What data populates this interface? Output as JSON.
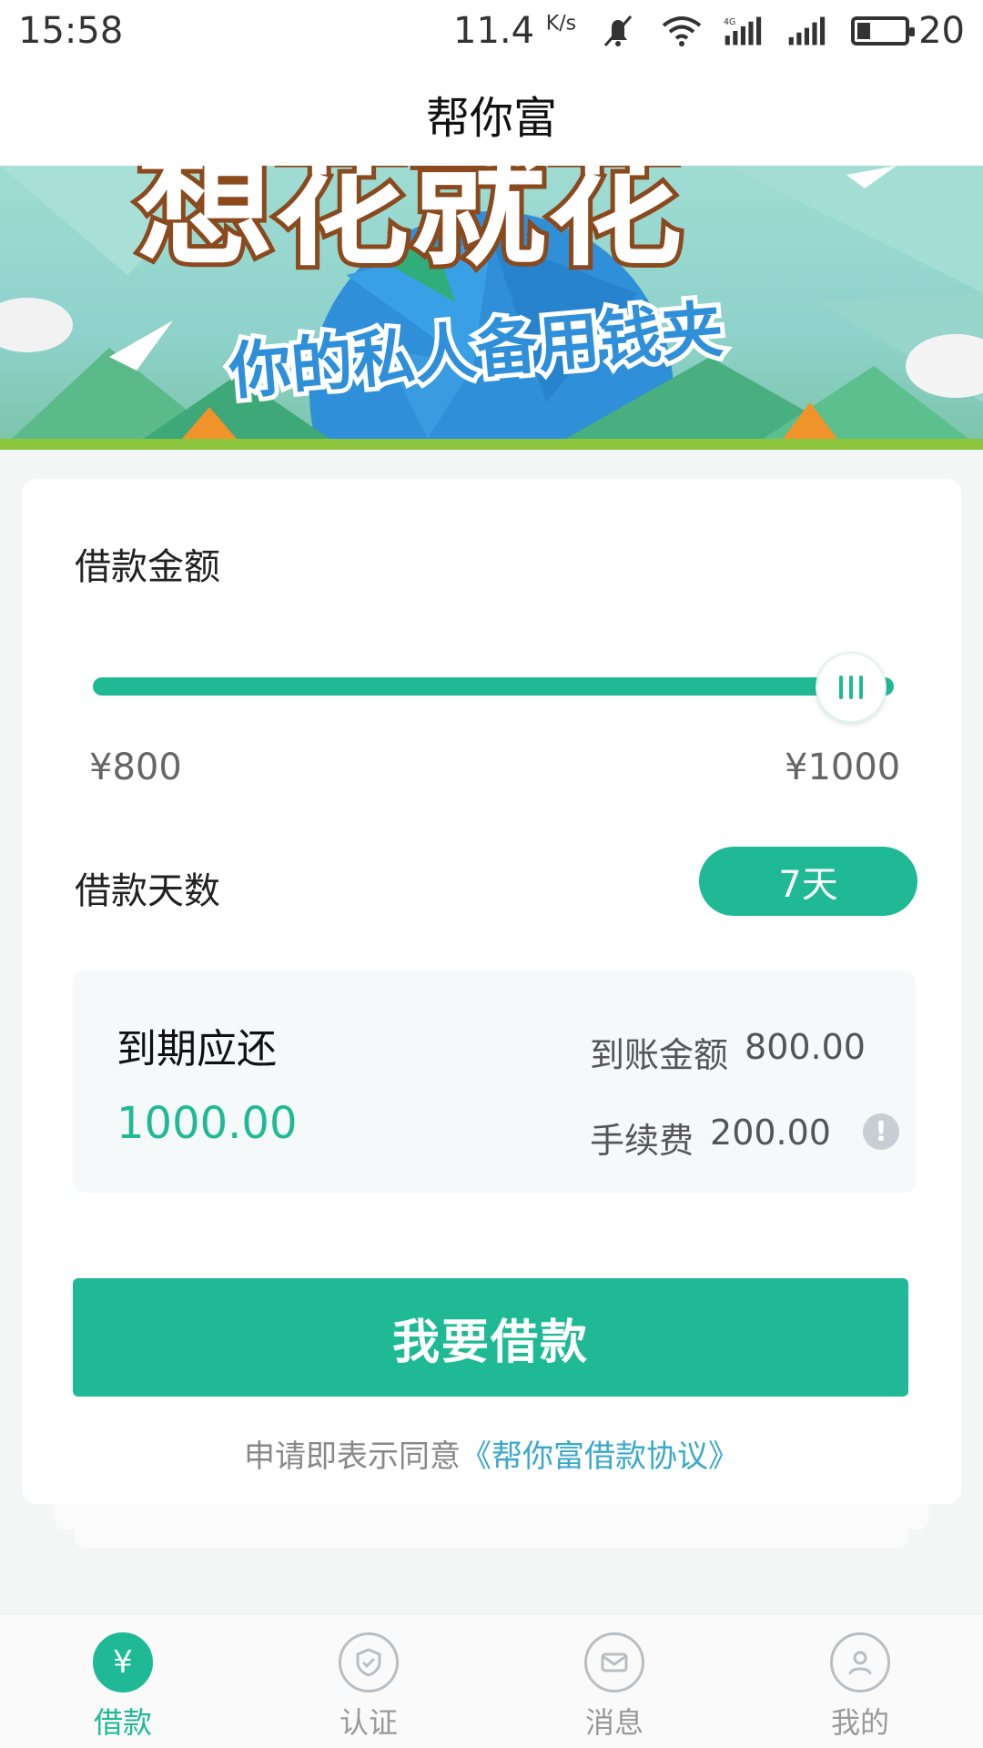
{
  "status_bar": {
    "time": "15:58",
    "speed_value": "11.4",
    "speed_unit": "K/s",
    "network": "4G",
    "battery": "20"
  },
  "nav": {
    "title": "帮你富"
  },
  "banner": {
    "headline": "想花就花",
    "tagline": "你的私人备用钱夹"
  },
  "loan": {
    "amount_label": "借款金额",
    "amount_min": "¥800",
    "amount_max": "¥1000",
    "slider_fraction": 1.0,
    "days_label": "借款天数",
    "days_value": "7天",
    "summary": {
      "due_title": "到期应还",
      "due_amount": "1000.00",
      "received_label": "到账金额",
      "received_value": "800.00",
      "fee_label": "手续费",
      "fee_value": "200.00"
    },
    "button_label": "我要借款",
    "agree_prefix": "申请即表示同意",
    "agree_link": "《帮你富借款协议》"
  },
  "tabs": [
    {
      "label": "借款",
      "icon": "yuan-icon",
      "active": true
    },
    {
      "label": "认证",
      "icon": "shield-check-icon",
      "active": false
    },
    {
      "label": "消息",
      "icon": "mail-icon",
      "active": false
    },
    {
      "label": "我的",
      "icon": "user-icon",
      "active": false
    }
  ],
  "colors": {
    "accent": "#1fba95",
    "link": "#3aa8c9"
  }
}
